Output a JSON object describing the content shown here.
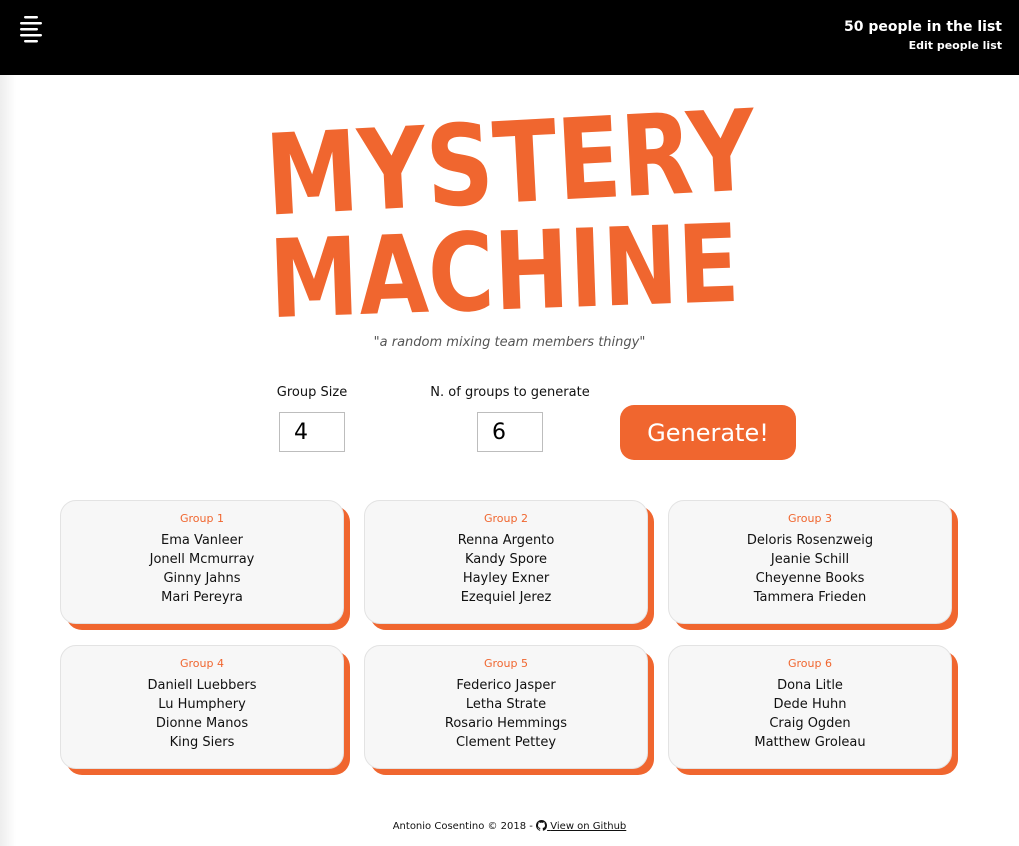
{
  "header": {
    "people_count": "50 people in the list",
    "edit_link": "Edit people list"
  },
  "logo": {
    "line1": "MYSTERY",
    "line2": "MACHINE",
    "color": "#f0662f"
  },
  "tagline": "\"a random mixing team members thingy\"",
  "controls": {
    "group_size_label": "Group Size",
    "group_size_value": "4",
    "groups_count_label": "N. of groups to generate",
    "groups_count_value": "6",
    "generate_label": "Generate!"
  },
  "groups": [
    {
      "title": "Group 1",
      "members": [
        "Ema Vanleer",
        "Jonell Mcmurray",
        "Ginny Jahns",
        "Mari Pereyra"
      ]
    },
    {
      "title": "Group 2",
      "members": [
        "Renna Argento",
        "Kandy Spore",
        "Hayley Exner",
        "Ezequiel Jerez"
      ]
    },
    {
      "title": "Group 3",
      "members": [
        "Deloris Rosenzweig",
        "Jeanie Schill",
        "Cheyenne Books",
        "Tammera Frieden"
      ]
    },
    {
      "title": "Group 4",
      "members": [
        "Daniell Luebbers",
        "Lu Humphery",
        "Dionne Manos",
        "King Siers"
      ]
    },
    {
      "title": "Group 5",
      "members": [
        "Federico Jasper",
        "Letha Strate",
        "Rosario Hemmings",
        "Clement Pettey"
      ]
    },
    {
      "title": "Group 6",
      "members": [
        "Dona Litle",
        "Dede Huhn",
        "Craig Ogden",
        "Matthew Groleau"
      ]
    }
  ],
  "footer": {
    "credit": "Antonio Cosentino © 2018 - ",
    "github_link": "View on Github"
  },
  "colors": {
    "accent": "#f0662f",
    "topbar": "#000000"
  },
  "icons": {
    "menu": "hamburger-menu-icon",
    "github": "github-icon"
  }
}
